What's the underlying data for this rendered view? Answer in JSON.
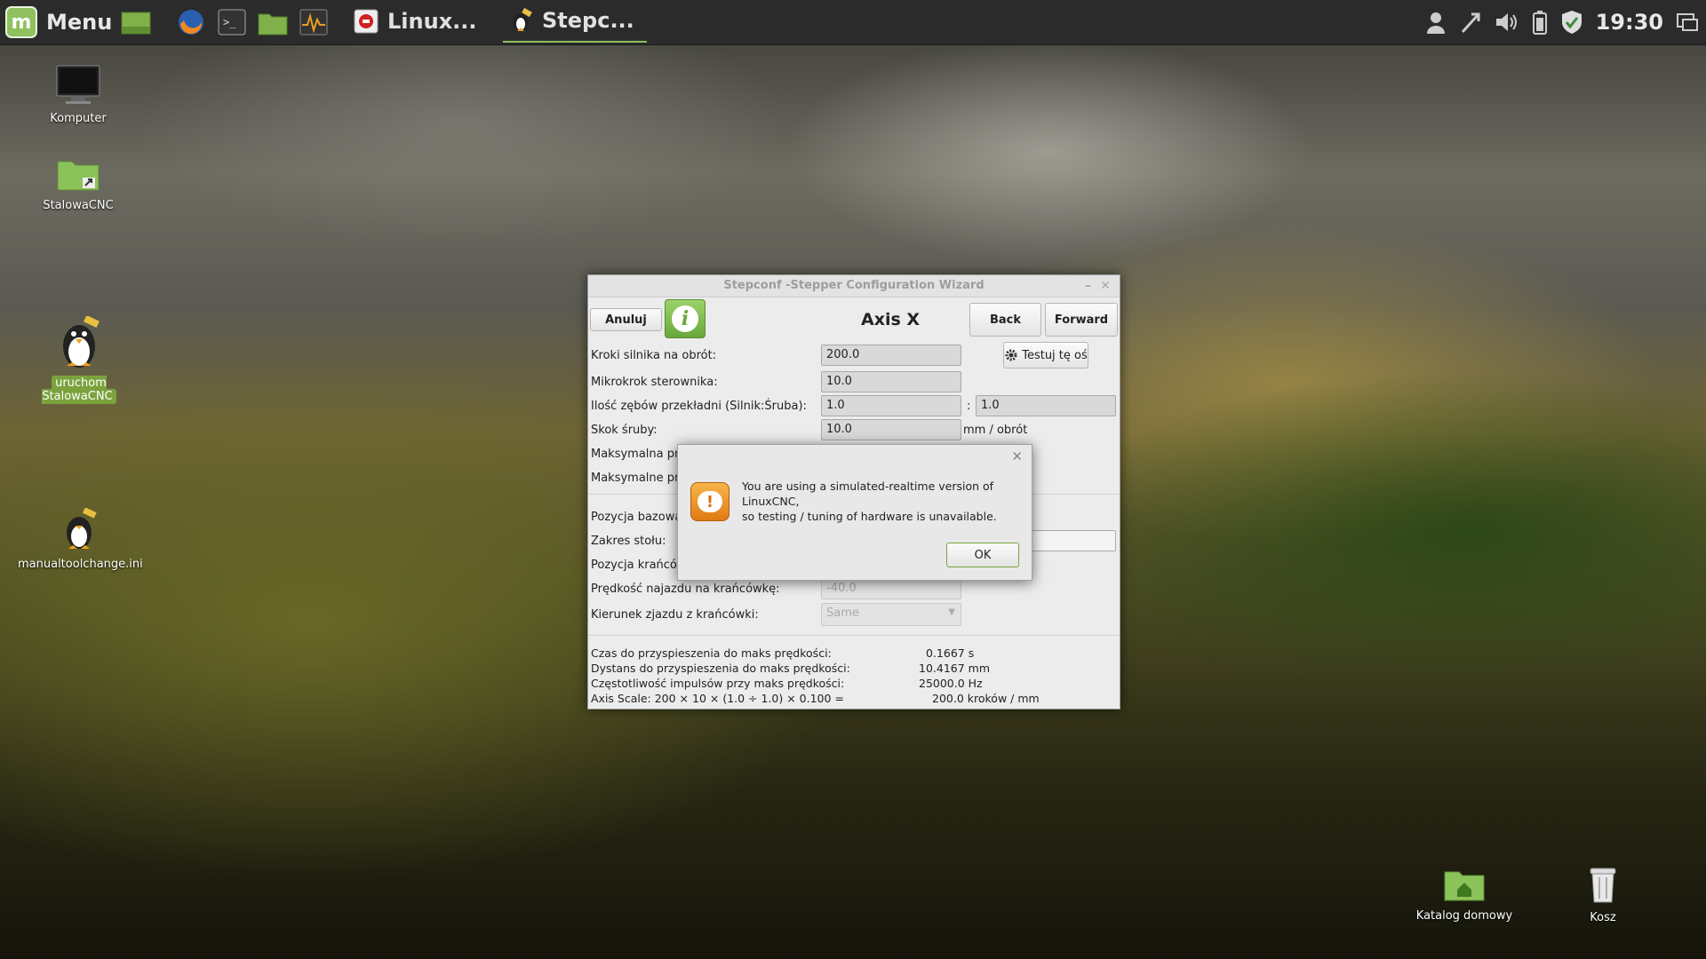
{
  "panel": {
    "menu_label": "Menu",
    "tasks": [
      {
        "label": "Linux..."
      },
      {
        "label": "Stepc..."
      }
    ],
    "clock": "19:30"
  },
  "desktop": {
    "icons": [
      {
        "label": "Komputer"
      },
      {
        "label": "StalowaCNC"
      },
      {
        "label": "uruchom StalowaCNC"
      },
      {
        "label": "manualtoolchange.ini"
      },
      {
        "label": "Katalog domowy"
      },
      {
        "label": "Kosz"
      }
    ]
  },
  "window": {
    "title": "Stepconf -Stepper Configuration Wizard",
    "cancel_label": "Anuluj",
    "page_title": "Axis X",
    "back_label": "Back",
    "forward_label": "Forward",
    "test_axis_label": "Testuj tę oś",
    "rows": {
      "steps_label": "Kroki silnika na obrót:",
      "steps_value": "200.0",
      "microstep_label": "Mikrokrok sterownika:",
      "microstep_value": "10.0",
      "gear_label": "Ilość zębów przekładni (Silnik:Śruba):",
      "gear_motor": "1.0",
      "gear_colon": ":",
      "gear_screw": "1.0",
      "pitch_label": "Skok śruby:",
      "pitch_value": "10.0",
      "pitch_unit": "mm / obrót",
      "maxvel_label": "Maksymalna prę",
      "maxacc_label": "Maksymalne przy",
      "home_label": "Pozycja bazowa:",
      "range_label": "Zakres stołu:",
      "limit_label": "Pozycja krańcówk",
      "homevel_label": "Prędkość najazdu na krańcówkę:",
      "homevel_value": "-40.0",
      "latchdir_label": "Kierunek zjazdu z krańcówki:",
      "latchdir_value": "Same"
    },
    "stats": {
      "accel_time_label": "Czas do przyspieszenia do maks prędkości:",
      "accel_time_value": "0.1667 s",
      "accel_dist_label": "Dystans do przyspieszenia do maks prędkości:",
      "accel_dist_value": "10.4167 mm",
      "pulse_label": "Częstotliwość impulsów przy maks prędkości:",
      "pulse_value": "25000.0 Hz",
      "scale_label": "Axis Scale: 200 × 10 × (1.0 ÷ 1.0) × 0.100 =",
      "scale_value": "200.0 kroków / mm"
    }
  },
  "dialog": {
    "message_line1": "You are using a simulated-realtime version of LinuxCNC,",
    "message_line2": "so testing / tuning of hardware is unavailable.",
    "ok_label": "OK"
  },
  "colors": {
    "accent": "#8fc15e",
    "panel_bg": "#2b2b2b",
    "warning": "#e8901c"
  }
}
